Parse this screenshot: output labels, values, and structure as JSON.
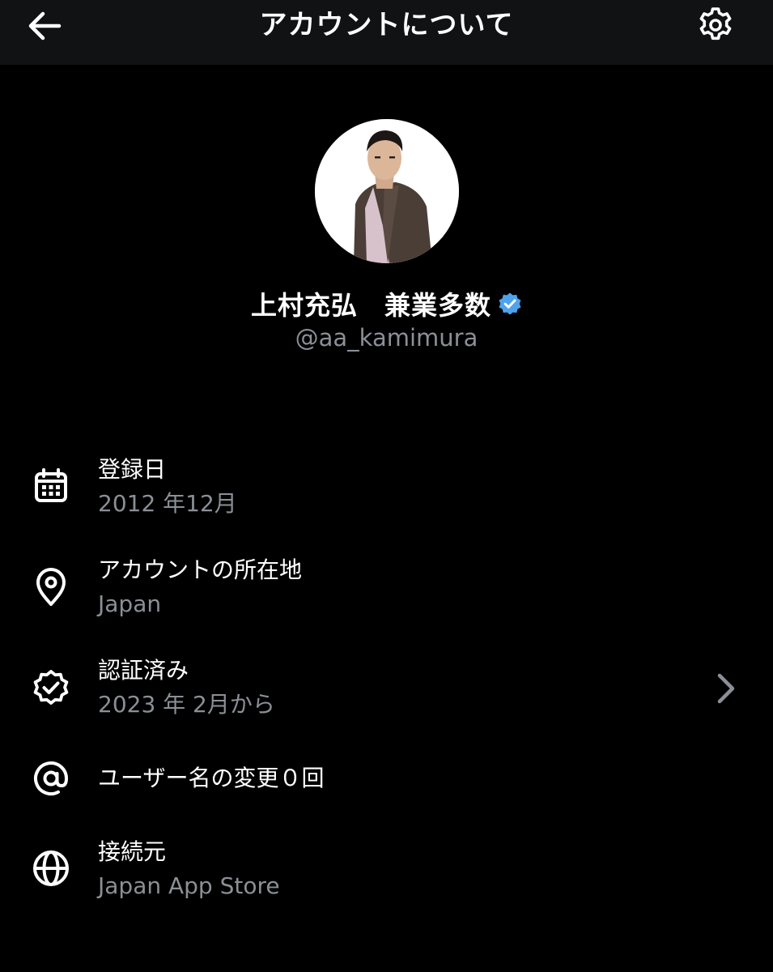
{
  "header": {
    "title": "アカウントについて",
    "back_icon": "arrow-left-icon",
    "settings_icon": "gear-icon"
  },
  "profile": {
    "display_name": "上村充弘　兼業多数",
    "handle": "@aa_kamimura",
    "verified": true,
    "verified_color": "#4fa3ee"
  },
  "details": [
    {
      "icon": "calendar-icon",
      "title": "登録日",
      "value": "2012 年12月"
    },
    {
      "icon": "location-pin-icon",
      "title": "アカウントの所在地",
      "value": "Japan"
    },
    {
      "icon": "verified-badge-icon",
      "title": "認証済み",
      "value": "2023 年 2月から",
      "has_chevron": true
    },
    {
      "icon": "at-sign-icon",
      "title": "ユーザー名の変更０回",
      "value": ""
    },
    {
      "icon": "globe-icon",
      "title": "接続元",
      "value": "Japan App Store"
    }
  ],
  "colors": {
    "background": "#000000",
    "header_background": "#111213",
    "secondary_text": "#8b8f96",
    "primary_text": "#ffffff"
  }
}
